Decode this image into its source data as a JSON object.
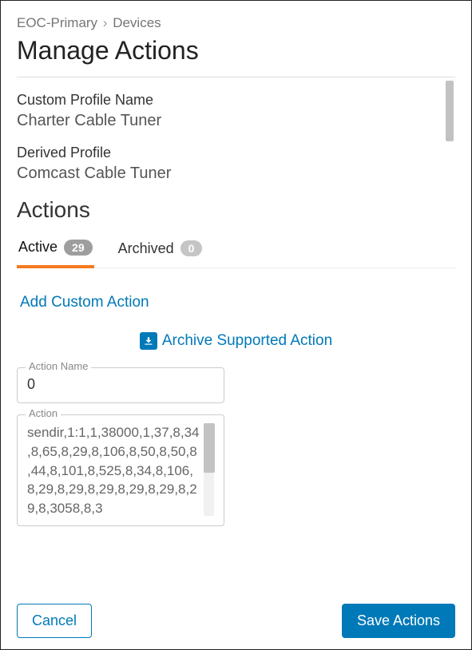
{
  "breadcrumb": {
    "root": "EOC-Primary",
    "sep": "›",
    "current": "Devices"
  },
  "page_title": "Manage Actions",
  "fields": {
    "custom_profile_label": "Custom Profile Name",
    "custom_profile_value": "Charter Cable Tuner",
    "derived_profile_label": "Derived Profile",
    "derived_profile_value": "Comcast Cable Tuner"
  },
  "actions_section_title": "Actions",
  "tabs": {
    "active": {
      "label": "Active",
      "count": "29"
    },
    "archived": {
      "label": "Archived",
      "count": "0"
    }
  },
  "links": {
    "add_custom": "Add Custom Action",
    "archive_supported": "Archive Supported Action"
  },
  "form": {
    "action_name_label": "Action Name",
    "action_name_value": "0",
    "action_label": "Action",
    "action_value": "sendir,1:1,1,38000,1,37,8,34,8,65,8,29,8,106,8,50,8,50,8,44,8,101,8,525,8,34,8,106,8,29,8,29,8,29,8,29,8,29,8,29,8,3058,8,3"
  },
  "footer": {
    "cancel": "Cancel",
    "save": "Save Actions"
  }
}
